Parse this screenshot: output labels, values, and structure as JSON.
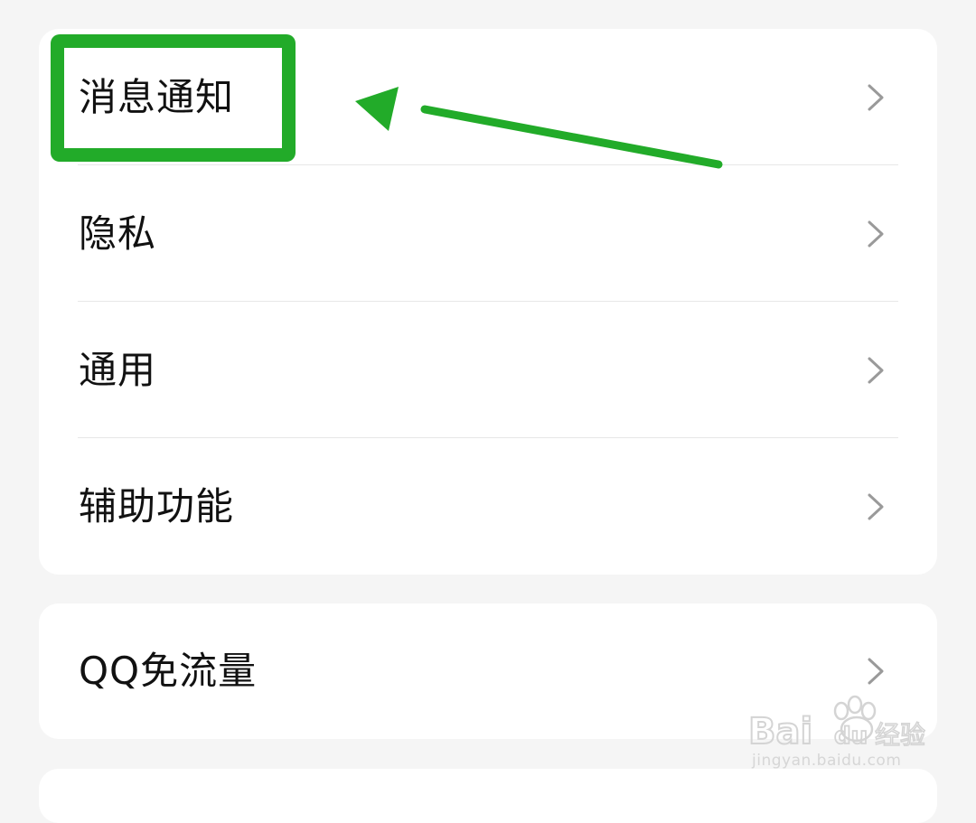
{
  "settings_groups": [
    {
      "items": [
        {
          "label": "消息通知"
        },
        {
          "label": "隐私"
        },
        {
          "label": "通用"
        },
        {
          "label": "辅助功能"
        }
      ]
    },
    {
      "items": [
        {
          "label": "QQ免流量"
        }
      ]
    }
  ],
  "icons": {
    "row_trailing": "chevron-right-icon"
  },
  "annotation": {
    "color": "#22ab29"
  },
  "watermark": {
    "brand": "Bai du 经验",
    "url": "jingyan.baidu.com"
  },
  "colors": {
    "background": "#f5f5f5",
    "card": "#ffffff",
    "divider": "#e7e7e7",
    "chevron": "#9a9a9a",
    "text": "#111111"
  }
}
